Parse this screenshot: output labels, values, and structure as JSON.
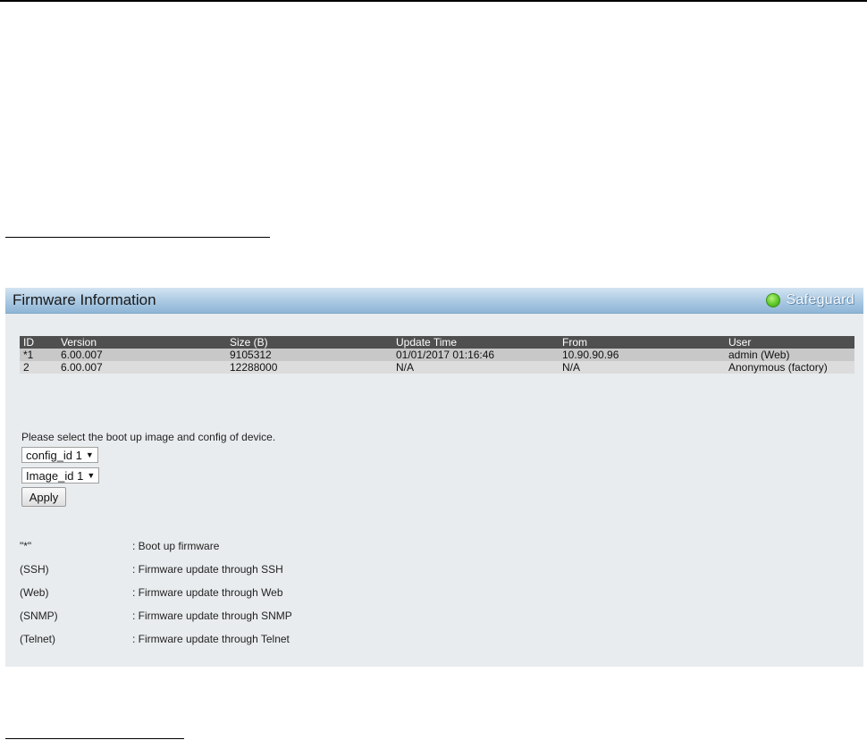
{
  "panel": {
    "title": "Firmware Information",
    "safeguard_label": "Safeguard"
  },
  "table": {
    "headers": [
      "ID",
      "Version",
      "Size (B)",
      "Update Time",
      "From",
      "User"
    ],
    "rows": [
      [
        "*1",
        "6.00.007",
        "9105312",
        "01/01/2017 01:16:46",
        "10.90.90.96",
        "admin (Web)"
      ],
      [
        "2",
        "6.00.007",
        "12288000",
        "N/A",
        "N/A",
        "Anonymous (factory)"
      ]
    ]
  },
  "boot": {
    "prompt": "Please select the boot up image and config of device.",
    "config_select_value": "config_id 1",
    "image_select_value": "Image_id 1",
    "apply_label": "Apply"
  },
  "legend": [
    {
      "symbol": "\"*\"",
      "description": ": Boot up firmware"
    },
    {
      "symbol": "(SSH)",
      "description": ": Firmware update through SSH"
    },
    {
      "symbol": "(Web)",
      "description": ": Firmware update through Web"
    },
    {
      "symbol": "(SNMP)",
      "description": ": Firmware update through SNMP"
    },
    {
      "symbol": "(Telnet)",
      "description": ": Firmware update through Telnet"
    }
  ],
  "colors": {
    "header_bar": "#a9c8e2",
    "table_header": "#4f4f4f",
    "safeguard_indicator": "#5ec92a"
  }
}
